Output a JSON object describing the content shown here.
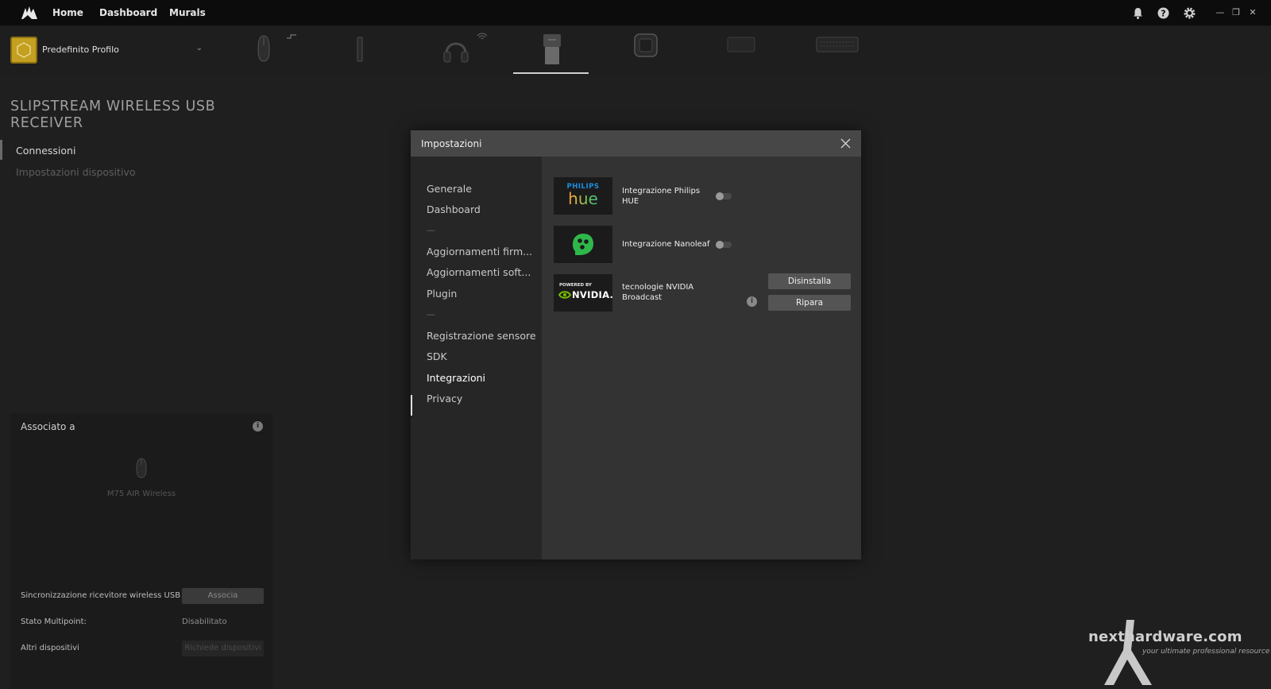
{
  "topbar": {
    "nav": [
      "Home",
      "Dashboard",
      "Murals"
    ],
    "icons": [
      "bell-icon",
      "help-icon",
      "gear-icon"
    ],
    "window_controls": [
      "minimize-icon",
      "restore-icon",
      "close-icon"
    ]
  },
  "profile": {
    "label": "Predefinito Profilo",
    "accent": "#c3a021"
  },
  "devices": [
    "mouse",
    "usb-dongle",
    "headset",
    "slipstream-receiver",
    "hub",
    "device-6",
    "keyboard"
  ],
  "left": {
    "title": "SLIPSTREAM WIRELESS USB RECEIVER",
    "nav": [
      {
        "label": "Connessioni",
        "active": true
      },
      {
        "label": "Impostazioni dispositivo",
        "active": false
      }
    ],
    "assoc": {
      "title": "Associato a",
      "device": "M75 AIR Wireless",
      "rows": [
        {
          "label": "Sincronizzazione ricevitore wireless USB",
          "button": "Associa"
        },
        {
          "label": "Stato Multipoint:",
          "value": "Disabilitato"
        },
        {
          "label": "Altri dispositivi",
          "button": "Richiede dispositivi"
        }
      ]
    }
  },
  "modal": {
    "title": "Impostazioni",
    "sidebar": [
      "Generale",
      "Dashboard",
      "—",
      "Aggiornamenti firm...",
      "Aggiornamenti soft...",
      "Plugin",
      "—",
      "Registrazione sensore",
      "SDK",
      "Integrazioni",
      "Privacy"
    ],
    "active_index": 9,
    "integrations": {
      "philips": {
        "logo_top": "PHILIPS",
        "logo_main": "hue",
        "label": "Integrazione Philips HUE",
        "enabled": false
      },
      "nanoleaf": {
        "label": "Integrazione Nanoleaf",
        "enabled": false
      },
      "nvidia": {
        "logo_top": "POWERED BY",
        "logo_main": "NVIDIA.",
        "label": "tecnologie NVIDIA Broadcast",
        "uninstall": "Disinstalla",
        "repair": "Ripara"
      }
    }
  },
  "watermark": {
    "text": "nexthardware.com",
    "sub": "your ultimate professional resource"
  }
}
